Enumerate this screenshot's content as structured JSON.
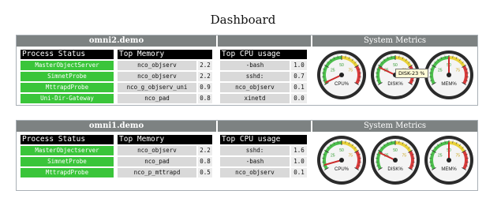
{
  "page": {
    "title": "Dashboard"
  },
  "panels": [
    {
      "host": "omni2.demo",
      "metrics_title": "System Metrics",
      "process_status_label": "Process Status",
      "top_memory_label": "Top Memory",
      "top_cpu_label": "Top CPU usage",
      "processes": [
        "MasterObjectServer",
        "SimnetProbe",
        "MttrapdProbe",
        "Uni-Dir-Gateway"
      ],
      "memory": [
        {
          "name": "nco_objserv",
          "value": "2.2"
        },
        {
          "name": "nco_objserv",
          "value": "2.2"
        },
        {
          "name": "nco_g_objserv_uni",
          "value": "0.9"
        },
        {
          "name": "nco_pad",
          "value": "0.8"
        }
      ],
      "cpu": [
        {
          "name": "-bash",
          "value": "1.0"
        },
        {
          "name": "sshd:",
          "value": "0.7"
        },
        {
          "name": "nco_objserv",
          "value": "0.1"
        },
        {
          "name": "xinetd",
          "value": "0.0"
        }
      ],
      "gauges": [
        {
          "label": "CPU%",
          "value": 2
        },
        {
          "label": "DISK%",
          "value": 23
        },
        {
          "label": "MEM%",
          "value": 50
        }
      ]
    },
    {
      "host": "omni1.demo",
      "metrics_title": "System Metrics",
      "process_status_label": "Process Status",
      "top_memory_label": "Top Memory",
      "top_cpu_label": "Top CPU usage",
      "processes": [
        "MasterObjectserver",
        "SimnetProbe",
        "MttrapdProbe"
      ],
      "memory": [
        {
          "name": "nco_objserv",
          "value": "2.2"
        },
        {
          "name": "nco_pad",
          "value": "0.8"
        },
        {
          "name": "nco_p_mttrapd",
          "value": "0.5"
        }
      ],
      "cpu": [
        {
          "name": "sshd:",
          "value": "1.6"
        },
        {
          "name": "-bash",
          "value": "1.0"
        },
        {
          "name": "nco_objserv",
          "value": "0.1"
        }
      ],
      "gauges": [
        {
          "label": "CPU%",
          "value": 6
        },
        {
          "label": "DISK%",
          "value": 23
        },
        {
          "label": "MEM%",
          "value": 50
        }
      ]
    }
  ],
  "gauge_scale": [
    "25",
    "50",
    "75"
  ],
  "tooltip": {
    "text": "DISK-23 %"
  },
  "colors": {
    "header": "#7d8282",
    "ok": "#3ac53a",
    "needle": "#cc2b2b"
  }
}
